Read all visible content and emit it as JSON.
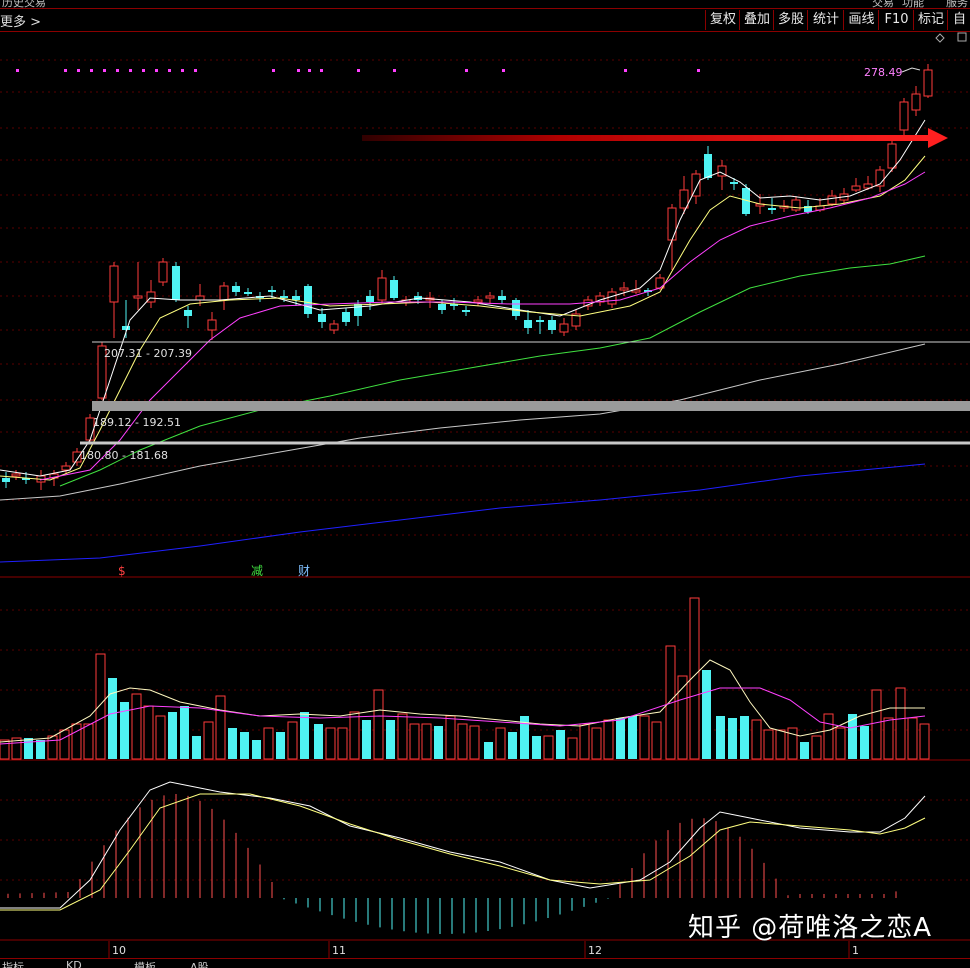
{
  "topbar": {
    "left_text": "历史交易",
    "right_items": [
      "交易",
      "功能",
      "服务"
    ]
  },
  "toolbar": {
    "more_label": "更多 >",
    "buttons": [
      "复权",
      "叠加",
      "多股",
      "统计",
      "画线",
      "F10",
      "标记",
      "自选"
    ]
  },
  "chart_data": {
    "type": "candlestick",
    "price_label_high": "278.49",
    "zones": [
      {
        "label": "207.31 - 207.39",
        "low": 207.31,
        "high": 207.39
      },
      {
        "label": "189.12 - 192.51",
        "low": 189.12,
        "high": 192.51
      },
      {
        "label": "180.80 - 181.68",
        "low": 180.8,
        "high": 181.68
      }
    ],
    "event_markers": [
      "$",
      "减",
      "财"
    ],
    "x_ticks": [
      "10",
      "11",
      "12",
      "1"
    ],
    "colors": {
      "up": "#ff3b3b",
      "down": "#4ff3f3",
      "ma5": "#ffffff",
      "ma10": "#ffff80",
      "ma20": "#ff40ff",
      "ma60": "#40e040",
      "ma120": "#c8c8c8",
      "ma250": "#2020ff",
      "arrow": "#ff2020"
    }
  },
  "watermark": "知乎 @荷唯洛之恋A",
  "bottom_tabs": [
    "指标",
    "KD",
    "模板",
    "A股"
  ]
}
